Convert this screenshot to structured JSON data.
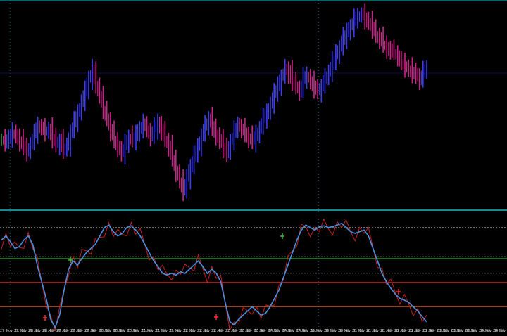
{
  "chart_data": {
    "type": "line",
    "title": "",
    "colors": {
      "background": "#000000",
      "bar_up": "#3d3df0",
      "bar_down": "#d0208a",
      "bar_neutral": "#2f9e3a",
      "separator": "#1fb8c7",
      "oscillator_line": "#4a8fe0",
      "oscillator_raw": "#c0221f",
      "level_green": "#2bb52b",
      "level_red": "#e0363f",
      "level_orange": "#e0703a",
      "dotted_level": "#8a8a8a",
      "signal_buy": "#3cc03c",
      "signal_sell": "#ff2a2a",
      "vertical_grid": "#2c7f88"
    },
    "price_series": [
      152,
      148,
      155,
      160,
      158,
      150,
      140,
      135,
      145,
      160,
      175,
      170,
      165,
      168,
      155,
      145,
      150,
      135,
      140,
      165,
      180,
      195,
      215,
      230,
      250,
      262,
      240,
      220,
      200,
      185,
      165,
      150,
      140,
      130,
      145,
      155,
      150,
      160,
      170,
      175,
      168,
      158,
      170,
      180,
      165,
      150,
      140,
      120,
      100,
      85,
      70,
      90,
      110,
      125,
      140,
      160,
      175,
      185,
      170,
      160,
      150,
      140,
      130,
      150,
      165,
      175,
      170,
      160,
      155,
      150,
      160,
      170,
      185,
      195,
      210,
      225,
      240,
      255,
      265,
      260,
      245,
      235,
      230,
      250,
      255,
      245,
      235,
      230,
      240,
      250,
      260,
      275,
      290,
      300,
      315,
      325,
      335,
      345,
      350,
      355,
      345,
      340,
      330,
      320,
      315,
      305,
      300,
      295,
      290,
      285,
      275,
      268,
      265,
      260,
      255,
      250,
      260,
      265
    ],
    "oscillator_series": [
      80,
      85,
      78,
      70,
      72,
      80,
      85,
      75,
      50,
      30,
      10,
      -15,
      -25,
      -10,
      20,
      45,
      55,
      50,
      58,
      65,
      70,
      75,
      85,
      95,
      98,
      90,
      85,
      88,
      95,
      97,
      92,
      85,
      75,
      65,
      55,
      48,
      40,
      38,
      40,
      38,
      42,
      40,
      45,
      50,
      55,
      48,
      40,
      45,
      40,
      30,
      5,
      -18,
      -22,
      -15,
      -10,
      -5,
      0,
      -5,
      -10,
      -8,
      0,
      10,
      20,
      35,
      50,
      65,
      80,
      92,
      98,
      95,
      92,
      96,
      97,
      95,
      96,
      98,
      100,
      95,
      90,
      88,
      90,
      92,
      85,
      70,
      55,
      40,
      30,
      22,
      15,
      10,
      8,
      5,
      0,
      -5,
      -12,
      -18
    ],
    "oscillator_levels": [
      80,
      50,
      30,
      10
    ],
    "oscillator_range": [
      -25,
      115
    ],
    "time_labels": [
      "27 Nov 11:00",
      "27 Nov 08:20",
      "27 Nov 08:40",
      "27 Nov 09:00",
      "27 Nov 09:20",
      "27 Nov 09:40",
      "27 Nov 10:00",
      "27 Nov 10:20",
      "27 Nov 10:40",
      "27 Nov 11:00",
      "27 Nov 11:20",
      "27 Nov 11:40",
      "27 Nov 12:00",
      "27 Nov 12:20",
      "27 Nov 12:40",
      "27 Nov 13:00",
      "27 Nov 13:20",
      "27 Nov 13:40",
      "27 Nov 14:00",
      "27 Nov 14:20",
      "27 Nov 14:40",
      "27 Nov 15:00",
      "28 Nov 00:20",
      "28 Nov 00:40",
      "28 Nov 01:00",
      "28 Nov 01:20",
      "28 Nov 01:40",
      "28 Nov 02:00",
      "28 Nov 02:20",
      "28 Nov 02:40",
      "28 Nov 03:00",
      "28 Nov 03:20",
      "28 Nov 03:40",
      "28 Nov 04:00",
      "28 Nov 04:20",
      "28 Nov 04:40"
    ]
  }
}
